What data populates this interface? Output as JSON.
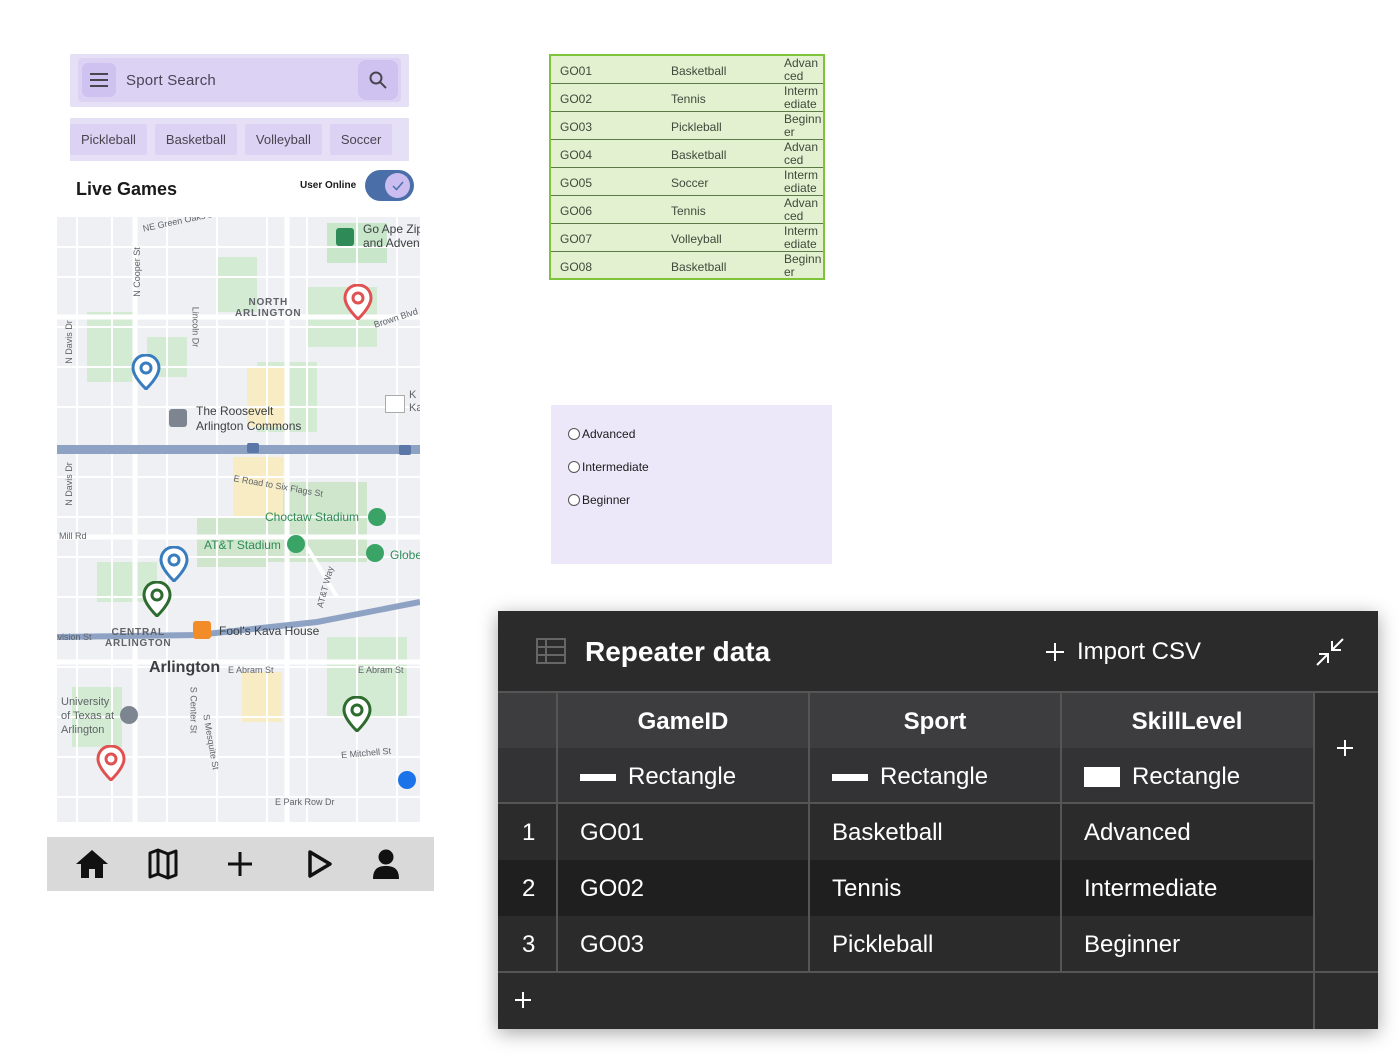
{
  "search": {
    "placeholder": "Sport Search"
  },
  "chips": [
    "Pickleball",
    "Basketball",
    "Volleyball",
    "Soccer"
  ],
  "live_games": {
    "title": "Live Games",
    "online_label": "User Online",
    "online": true
  },
  "map": {
    "labels": {
      "north_arlington": "NORTH\nARLINGTON",
      "roosevelt": "The Roosevelt\nArlington Commons",
      "choctaw": "Choctaw Stadium",
      "att": "AT&T Stadium",
      "fools": "Fool's Kava House",
      "arlington": "Arlington",
      "central": "CENTRAL\nARLINGTON",
      "uta": "University\nof Texas at\nArlington",
      "go_ape": "Go Ape Zip\nand Adven",
      "globe": "Globe",
      "road_six_flags": "E Road to Six Flags St",
      "e_abram": "E Abram St",
      "e_abram2": "E Abram St",
      "e_mitchell": "E Mitchell St",
      "e_park_row": "E Park Row Dr",
      "mill_rd": "Mill Rd",
      "division": "Division St",
      "n_cooper": "N Cooper St",
      "n_davis": "N Davis Dr",
      "n_davis2": "N Davis Dr",
      "lincoln": "Lincoln Dr",
      "brown": "Brown Blvd",
      "att_way": "AT&T Way",
      "s_center": "S Center St",
      "s_mesquite": "S Mesquite St",
      "ne_green_oaks": "NE Green Oaks Blvd",
      "kk": "K\nKa"
    },
    "pins": [
      {
        "color": "#e05252"
      },
      {
        "color": "#3a7dbf"
      },
      {
        "color": "#3a7dbf"
      },
      {
        "color": "#2e6b2e"
      },
      {
        "color": "#2e6b2e"
      },
      {
        "color": "#e05252"
      }
    ]
  },
  "nav": [
    "home-icon",
    "map-icon",
    "plus-icon",
    "play-icon",
    "person-icon"
  ],
  "green_table": [
    {
      "id": "GO01",
      "sport": "Basketball",
      "skill": "Advanced"
    },
    {
      "id": "GO02",
      "sport": "Tennis",
      "skill": "Intermediate"
    },
    {
      "id": "GO03",
      "sport": "Pickleball",
      "skill": "Beginner"
    },
    {
      "id": "GO04",
      "sport": "Basketball",
      "skill": "Advanced"
    },
    {
      "id": "GO05",
      "sport": "Soccer",
      "skill": "Intermediate"
    },
    {
      "id": "GO06",
      "sport": "Tennis",
      "skill": "Advanced"
    },
    {
      "id": "GO07",
      "sport": "Volleyball",
      "skill": "Intermediate"
    },
    {
      "id": "GO08",
      "sport": "Basketball",
      "skill": "Beginner"
    }
  ],
  "radio": [
    "Advanced",
    "Intermediate",
    "Beginner"
  ],
  "repeater": {
    "title": "Repeater data",
    "import_label": "Import CSV",
    "columns": [
      "GameID",
      "Sport",
      "SkillLevel"
    ],
    "types": [
      "Rectangle",
      "Rectangle",
      "Rectangle"
    ],
    "rows": [
      {
        "n": "1",
        "id": "GO01",
        "sport": "Basketball",
        "skill": "Advanced"
      },
      {
        "n": "2",
        "id": "GO02",
        "sport": "Tennis",
        "skill": "Intermediate"
      },
      {
        "n": "3",
        "id": "GO03",
        "sport": "Pickleball",
        "skill": "Beginner"
      }
    ]
  }
}
